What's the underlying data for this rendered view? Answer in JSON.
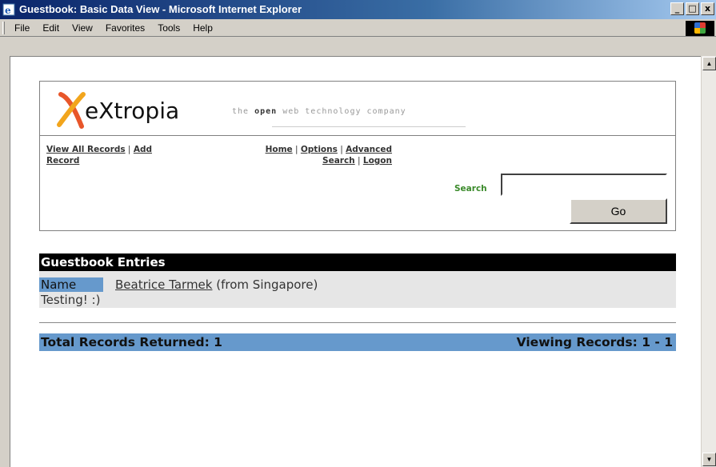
{
  "window": {
    "title": "Guestbook: Basic Data View - Microsoft Internet Explorer",
    "controls": {
      "minimize": "_",
      "maximize": "□",
      "close": "x"
    }
  },
  "menu": [
    {
      "label": "File"
    },
    {
      "label": "Edit"
    },
    {
      "label": "View"
    },
    {
      "label": "Favorites"
    },
    {
      "label": "Tools"
    },
    {
      "label": "Help"
    }
  ],
  "brand": {
    "logo_text": "eXtropia",
    "tagline_pre": "the ",
    "tagline_bold": "open",
    "tagline_post": " web technology company",
    "accent_colors": [
      "#e8562a",
      "#f2a51c"
    ]
  },
  "nav": {
    "view_all": "View All Records",
    "add": "Add",
    "record": "Record",
    "home": "Home",
    "options": "Options",
    "advanced": "Advanced",
    "search": "Search",
    "logon": "Logon",
    "sep": " | "
  },
  "search": {
    "label": "Search",
    "value": "",
    "button": "Go"
  },
  "entries": {
    "title": "Guestbook Entries",
    "name_label": "Name",
    "name": "Beatrice Tarmek",
    "from": "(from Singapore)",
    "comment": "Testing! :)"
  },
  "footer": {
    "total": "Total Records Returned: 1",
    "viewing": "Viewing Records: 1 - 1"
  },
  "colors": {
    "title_bar": "#0a246a",
    "header_bg": "#000000",
    "highlight": "#6699cc",
    "entry_bg": "#e6e6e6",
    "search_label": "#3a8a2a"
  }
}
